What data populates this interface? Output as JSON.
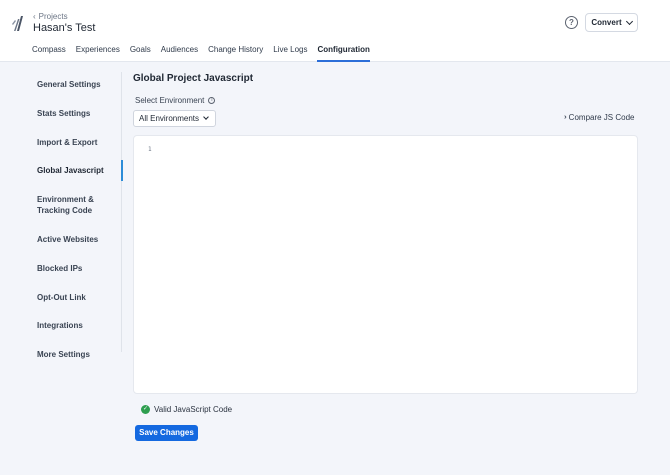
{
  "header": {
    "back_label": "Projects",
    "project_name": "Hasan's Test",
    "help_glyph": "?",
    "account_label": "Convert",
    "icons": {
      "logo": "app-logo-icon",
      "back": "chevron-left-icon",
      "help": "help-circle-icon",
      "account_caret": "chevron-down-icon"
    }
  },
  "tabs": [
    {
      "label": "Compass"
    },
    {
      "label": "Experiences"
    },
    {
      "label": "Goals"
    },
    {
      "label": "Audiences"
    },
    {
      "label": "Change History"
    },
    {
      "label": "Live Logs"
    },
    {
      "label": "Configuration",
      "active": true
    }
  ],
  "sidebar": {
    "items": [
      {
        "label": "General Settings"
      },
      {
        "label": "Stats Settings"
      },
      {
        "label": "Import & Export"
      },
      {
        "label": "Global Javascript",
        "active": true
      },
      {
        "label": "Environment &",
        "label2": "Tracking Code"
      },
      {
        "label": "Active Websites"
      },
      {
        "label": "Blocked IPs"
      },
      {
        "label": "Opt-Out Link"
      },
      {
        "label": "Integrations"
      },
      {
        "label": "More Settings"
      }
    ]
  },
  "main": {
    "title": "Global Project Javascript",
    "env_label": "Select Environment",
    "env_value": "All Environments",
    "compare_label": "Compare JS Code",
    "editor": {
      "line_number": "1",
      "content": ""
    },
    "validation_text": "Valid JavaScript Code",
    "save_label": "Save Changes"
  },
  "colors": {
    "accent": "#1469e0",
    "tab_underline": "#2c6ed8",
    "valid": "#2e9e4f",
    "background": "#f3f5fa"
  }
}
